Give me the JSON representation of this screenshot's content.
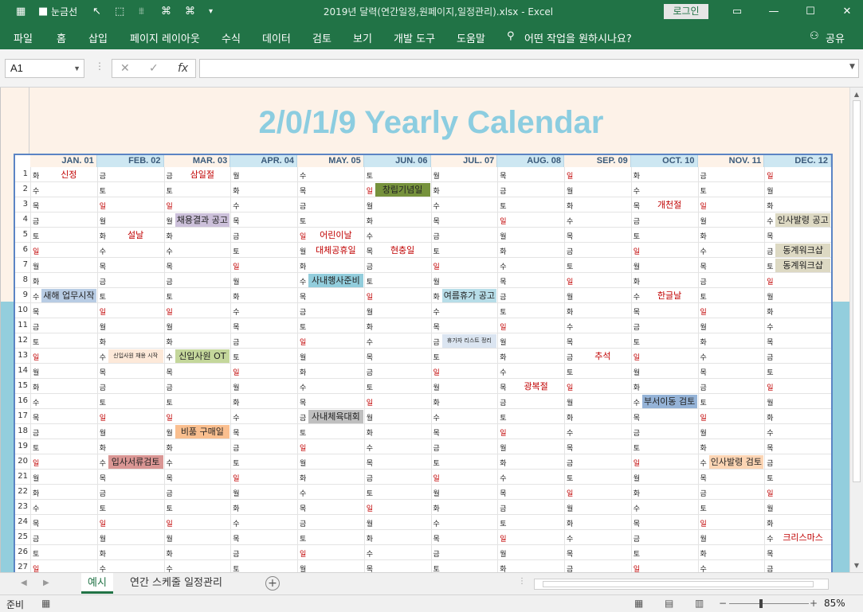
{
  "window": {
    "title": "2019년 달력(연간일정,원페이지,일정관리).xlsx  -  Excel",
    "gridlines_label": "눈금선",
    "login_label": "로그인"
  },
  "ribbon": {
    "tabs": [
      "파일",
      "홈",
      "삽입",
      "페이지 레이아웃",
      "수식",
      "데이터",
      "검토",
      "보기",
      "개발 도구",
      "도움말",
      "어떤 작업을 원하시나요?"
    ],
    "share_label": "공유"
  },
  "formula_bar": {
    "name_box": "A1",
    "fx": "fx",
    "value": ""
  },
  "calendar": {
    "title": "2/0/1/9 Yearly Calendar",
    "months": [
      "JAN. 01",
      "FEB. 02",
      "MAR. 03",
      "APR. 04",
      "MAY. 05",
      "JUN. 06",
      "JUL. 07",
      "AUG. 08",
      "SEP. 09",
      "OCT. 10",
      "NOV. 11",
      "DEC. 12"
    ],
    "days": [
      [
        "화",
        "금",
        "금",
        "월",
        "수",
        "토",
        "월",
        "목",
        "일",
        "화",
        "금",
        "일"
      ],
      [
        "수",
        "토",
        "토",
        "화",
        "목",
        "일",
        "화",
        "금",
        "월",
        "수",
        "토",
        "월"
      ],
      [
        "목",
        "일",
        "일",
        "수",
        "금",
        "월",
        "수",
        "토",
        "화",
        "목",
        "일",
        "화"
      ],
      [
        "금",
        "월",
        "월",
        "목",
        "토",
        "화",
        "목",
        "일",
        "수",
        "금",
        "월",
        "수"
      ],
      [
        "토",
        "화",
        "화",
        "금",
        "일",
        "수",
        "금",
        "월",
        "목",
        "토",
        "화",
        "목"
      ],
      [
        "일",
        "수",
        "수",
        "토",
        "월",
        "목",
        "토",
        "화",
        "금",
        "일",
        "수",
        "금"
      ],
      [
        "월",
        "목",
        "목",
        "일",
        "화",
        "금",
        "일",
        "수",
        "토",
        "월",
        "목",
        "토"
      ],
      [
        "화",
        "금",
        "금",
        "월",
        "수",
        "토",
        "월",
        "목",
        "일",
        "화",
        "금",
        "일"
      ],
      [
        "수",
        "토",
        "토",
        "화",
        "목",
        "일",
        "화",
        "금",
        "월",
        "수",
        "토",
        "월"
      ],
      [
        "목",
        "일",
        "일",
        "수",
        "금",
        "월",
        "수",
        "토",
        "화",
        "목",
        "일",
        "화"
      ],
      [
        "금",
        "월",
        "월",
        "목",
        "토",
        "화",
        "목",
        "일",
        "수",
        "금",
        "월",
        "수"
      ],
      [
        "토",
        "화",
        "화",
        "금",
        "일",
        "수",
        "금",
        "월",
        "목",
        "토",
        "화",
        "목"
      ],
      [
        "일",
        "수",
        "수",
        "토",
        "월",
        "목",
        "토",
        "화",
        "금",
        "일",
        "수",
        "금"
      ],
      [
        "월",
        "목",
        "목",
        "일",
        "화",
        "금",
        "일",
        "수",
        "토",
        "월",
        "목",
        "토"
      ],
      [
        "화",
        "금",
        "금",
        "월",
        "수",
        "토",
        "월",
        "목",
        "일",
        "화",
        "금",
        "일"
      ],
      [
        "수",
        "토",
        "토",
        "화",
        "목",
        "일",
        "화",
        "금",
        "월",
        "수",
        "토",
        "월"
      ],
      [
        "목",
        "일",
        "일",
        "수",
        "금",
        "월",
        "수",
        "토",
        "화",
        "목",
        "일",
        "화"
      ],
      [
        "금",
        "월",
        "월",
        "목",
        "토",
        "화",
        "목",
        "일",
        "수",
        "금",
        "월",
        "수"
      ],
      [
        "토",
        "화",
        "화",
        "금",
        "일",
        "수",
        "금",
        "월",
        "목",
        "토",
        "화",
        "목"
      ],
      [
        "일",
        "수",
        "수",
        "토",
        "월",
        "목",
        "토",
        "화",
        "금",
        "일",
        "수",
        "금"
      ],
      [
        "월",
        "목",
        "목",
        "일",
        "화",
        "금",
        "일",
        "수",
        "토",
        "월",
        "목",
        "토"
      ],
      [
        "화",
        "금",
        "금",
        "월",
        "수",
        "토",
        "월",
        "목",
        "일",
        "화",
        "금",
        "일"
      ],
      [
        "수",
        "토",
        "토",
        "화",
        "목",
        "일",
        "화",
        "금",
        "월",
        "수",
        "토",
        "월"
      ],
      [
        "목",
        "일",
        "일",
        "수",
        "금",
        "월",
        "수",
        "토",
        "화",
        "목",
        "일",
        "화"
      ],
      [
        "금",
        "월",
        "월",
        "목",
        "토",
        "화",
        "목",
        "일",
        "수",
        "금",
        "월",
        "수"
      ],
      [
        "토",
        "화",
        "화",
        "금",
        "일",
        "수",
        "금",
        "월",
        "목",
        "토",
        "화",
        "목"
      ],
      [
        "일",
        "수",
        "수",
        "토",
        "월",
        "목",
        "토",
        "화",
        "금",
        "일",
        "수",
        "금"
      ]
    ],
    "events": [
      {
        "day": 1,
        "month": 1,
        "text": "신정",
        "bg": "",
        "red": true
      },
      {
        "day": 1,
        "month": 3,
        "text": "삼일절",
        "bg": "",
        "red": true
      },
      {
        "day": 2,
        "month": 6,
        "text": "창립기념일",
        "bg": "#76923c",
        "red": false
      },
      {
        "day": 3,
        "month": 10,
        "text": "개천절",
        "bg": "",
        "red": true
      },
      {
        "day": 4,
        "month": 3,
        "text": "채용결과 공고",
        "bg": "#ccc0da",
        "red": false
      },
      {
        "day": 4,
        "month": 12,
        "text": "인사발령 공고",
        "bg": "#ddd9c3",
        "red": false
      },
      {
        "day": 5,
        "month": 2,
        "text": "설날",
        "bg": "",
        "red": true
      },
      {
        "day": 5,
        "month": 5,
        "text": "어린이날",
        "bg": "",
        "red": true
      },
      {
        "day": 6,
        "month": 5,
        "text": "대체공휴일",
        "bg": "",
        "red": true
      },
      {
        "day": 6,
        "month": 6,
        "text": "현충일",
        "bg": "",
        "red": true
      },
      {
        "day": 6,
        "month": 12,
        "text": "동계워크샵",
        "bg": "#ddd9c3",
        "red": false
      },
      {
        "day": 7,
        "month": 12,
        "text": "동계워크샵",
        "bg": "#ddd9c3",
        "red": false
      },
      {
        "day": 8,
        "month": 5,
        "text": "사내행사준비",
        "bg": "#92cddc",
        "red": false
      },
      {
        "day": 9,
        "month": 1,
        "text": "새해 업무시작",
        "bg": "#b8cce4",
        "red": false
      },
      {
        "day": 9,
        "month": 7,
        "text": "여름휴가 공고",
        "bg": "#b7dde8",
        "red": false
      },
      {
        "day": 9,
        "month": 10,
        "text": "한글날",
        "bg": "",
        "red": true
      },
      {
        "day": 12,
        "month": 7,
        "text": "휴가자 리스트 정리",
        "bg": "#dbe5f1",
        "red": false,
        "small": true
      },
      {
        "day": 13,
        "month": 2,
        "text": "신입사원 채용 시작",
        "bg": "#fde9d9",
        "red": false,
        "small": true
      },
      {
        "day": 13,
        "month": 3,
        "text": "신입사원 OT",
        "bg": "#c4d79b",
        "red": false
      },
      {
        "day": 13,
        "month": 9,
        "text": "추석",
        "bg": "",
        "red": true
      },
      {
        "day": 15,
        "month": 8,
        "text": "광복절",
        "bg": "",
        "red": true
      },
      {
        "day": 16,
        "month": 10,
        "text": "부서이동 검토",
        "bg": "#95b3d7",
        "red": false
      },
      {
        "day": 17,
        "month": 5,
        "text": "사내체육대회",
        "bg": "#bfbfbf",
        "red": false
      },
      {
        "day": 18,
        "month": 3,
        "text": "비품 구매일",
        "bg": "#fabf8f",
        "red": false
      },
      {
        "day": 20,
        "month": 2,
        "text": "입사서류검토",
        "bg": "#da9694",
        "red": false
      },
      {
        "day": 20,
        "month": 11,
        "text": "인사발령 검토",
        "bg": "#fcd5b4",
        "red": false
      },
      {
        "day": 25,
        "month": 12,
        "text": "크리스마스",
        "bg": "",
        "red": true
      }
    ]
  },
  "sheets": {
    "tabs": [
      "예시",
      "연간 스케줄 일정관리"
    ],
    "active": 0
  },
  "status": {
    "ready": "준비",
    "zoom": "85%"
  }
}
